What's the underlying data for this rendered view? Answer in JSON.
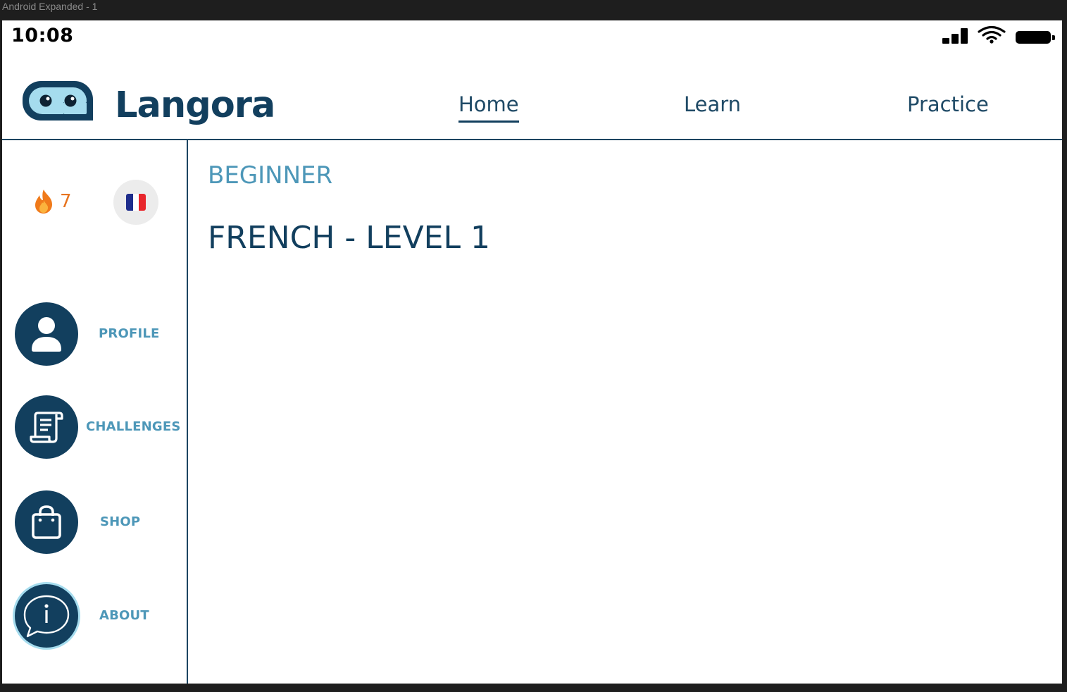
{
  "frame": {
    "label": "Android Expanded - 1"
  },
  "status_bar": {
    "time": "10:08",
    "icons": [
      "signal-icon",
      "wifi-icon",
      "battery-icon"
    ]
  },
  "header": {
    "brand": "Langora",
    "logo_icon": "robot-face-icon",
    "nav": [
      {
        "label": "Home",
        "active": true
      },
      {
        "label": "Learn",
        "active": false
      },
      {
        "label": "Practice",
        "active": false
      }
    ]
  },
  "sidebar": {
    "streak": {
      "icon": "flame-icon",
      "count": "7"
    },
    "language_flag": "french-flag-icon",
    "items": [
      {
        "label": "PROFILE",
        "icon": "user-icon"
      },
      {
        "label": "CHALLENGES",
        "icon": "scroll-icon"
      },
      {
        "label": "SHOP",
        "icon": "shopping-bag-icon"
      },
      {
        "label": "ABOUT",
        "icon": "info-bubble-icon"
      }
    ]
  },
  "main": {
    "level_tag": "BEGINNER",
    "course_title": "FRENCH - LEVEL 1"
  },
  "colors": {
    "primary": "#123f5e",
    "accent": "#4d97b8",
    "streak": "#e7741f",
    "ring": "#a5dcee",
    "logo_face": "#a5dcee"
  }
}
